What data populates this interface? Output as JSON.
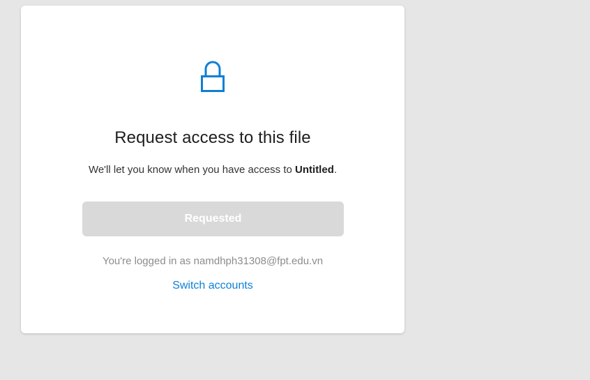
{
  "dialog": {
    "title": "Request access to this file",
    "subtitle_prefix": "We'll let you know when you have access to ",
    "file_name": "Untitled",
    "subtitle_suffix": ".",
    "request_button_label": "Requested",
    "logged_in_text": "You're logged in as namdhph31308@fpt.edu.vn",
    "switch_accounts_label": "Switch accounts",
    "lock_icon": "lock-icon"
  },
  "colors": {
    "background": "#e6e6e6",
    "card": "#ffffff",
    "accent": "#0d7fd6",
    "button_disabled": "#d9d9d9"
  }
}
